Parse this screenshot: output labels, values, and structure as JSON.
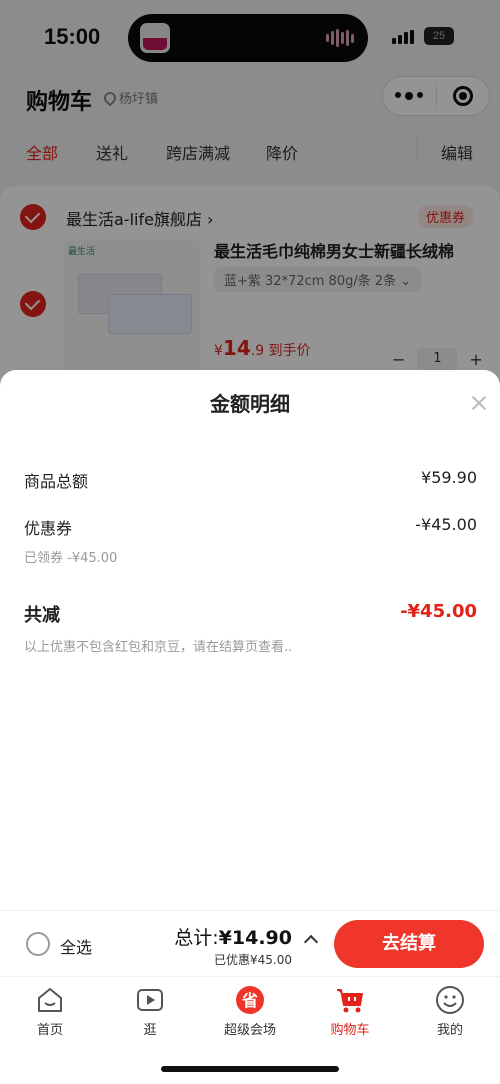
{
  "status_bar": {
    "time": "15:00",
    "battery": "25"
  },
  "header": {
    "title": "购物车",
    "location": "杨圩镇"
  },
  "tabs": [
    {
      "label": "全部",
      "active": true
    },
    {
      "label": "送礼",
      "active": false
    },
    {
      "label": "跨店满减",
      "active": false
    },
    {
      "label": "降价",
      "active": false
    }
  ],
  "edit_label": "编辑",
  "shop": {
    "name": "最生活a-life旗舰店 ›",
    "coupon_tag": "优惠券",
    "product": {
      "brand": "最生活",
      "title": "最生活毛巾纯棉男女士新疆长绒棉",
      "sku": "蓝+紫 32*72cm 80g/条 2条  ⌄",
      "price_symbol": "¥",
      "price_int": "14",
      "price_dec": ".9",
      "price_suffix": " 到手价",
      "minus": "−",
      "quantity": "1",
      "plus": "+"
    }
  },
  "sheet": {
    "title": "金额明细",
    "rows": [
      {
        "label": "商品总额",
        "value": "¥59.90"
      },
      {
        "label": "优惠券",
        "value": "-¥45.00",
        "sub": "已领券 -¥45.00"
      }
    ],
    "total": {
      "label": "共减",
      "value": "-¥45.00"
    },
    "note": "以上优惠不包含红包和京豆，请在结算页查看.."
  },
  "checkout": {
    "select_all": "全选",
    "total_prefix": "总计:",
    "total_amount": "¥14.90",
    "saved": "已优惠¥45.00",
    "button": "去结算"
  },
  "tabbar": [
    {
      "label": "首页",
      "icon": "home-icon"
    },
    {
      "label": "逛",
      "icon": "video-icon"
    },
    {
      "label": "超级会场",
      "icon": "sale-icon"
    },
    {
      "label": "购物车",
      "icon": "cart-icon",
      "active": true
    },
    {
      "label": "我的",
      "icon": "profile-icon"
    }
  ],
  "colors": {
    "accent": "#e2231a",
    "button": "#f0352b"
  }
}
